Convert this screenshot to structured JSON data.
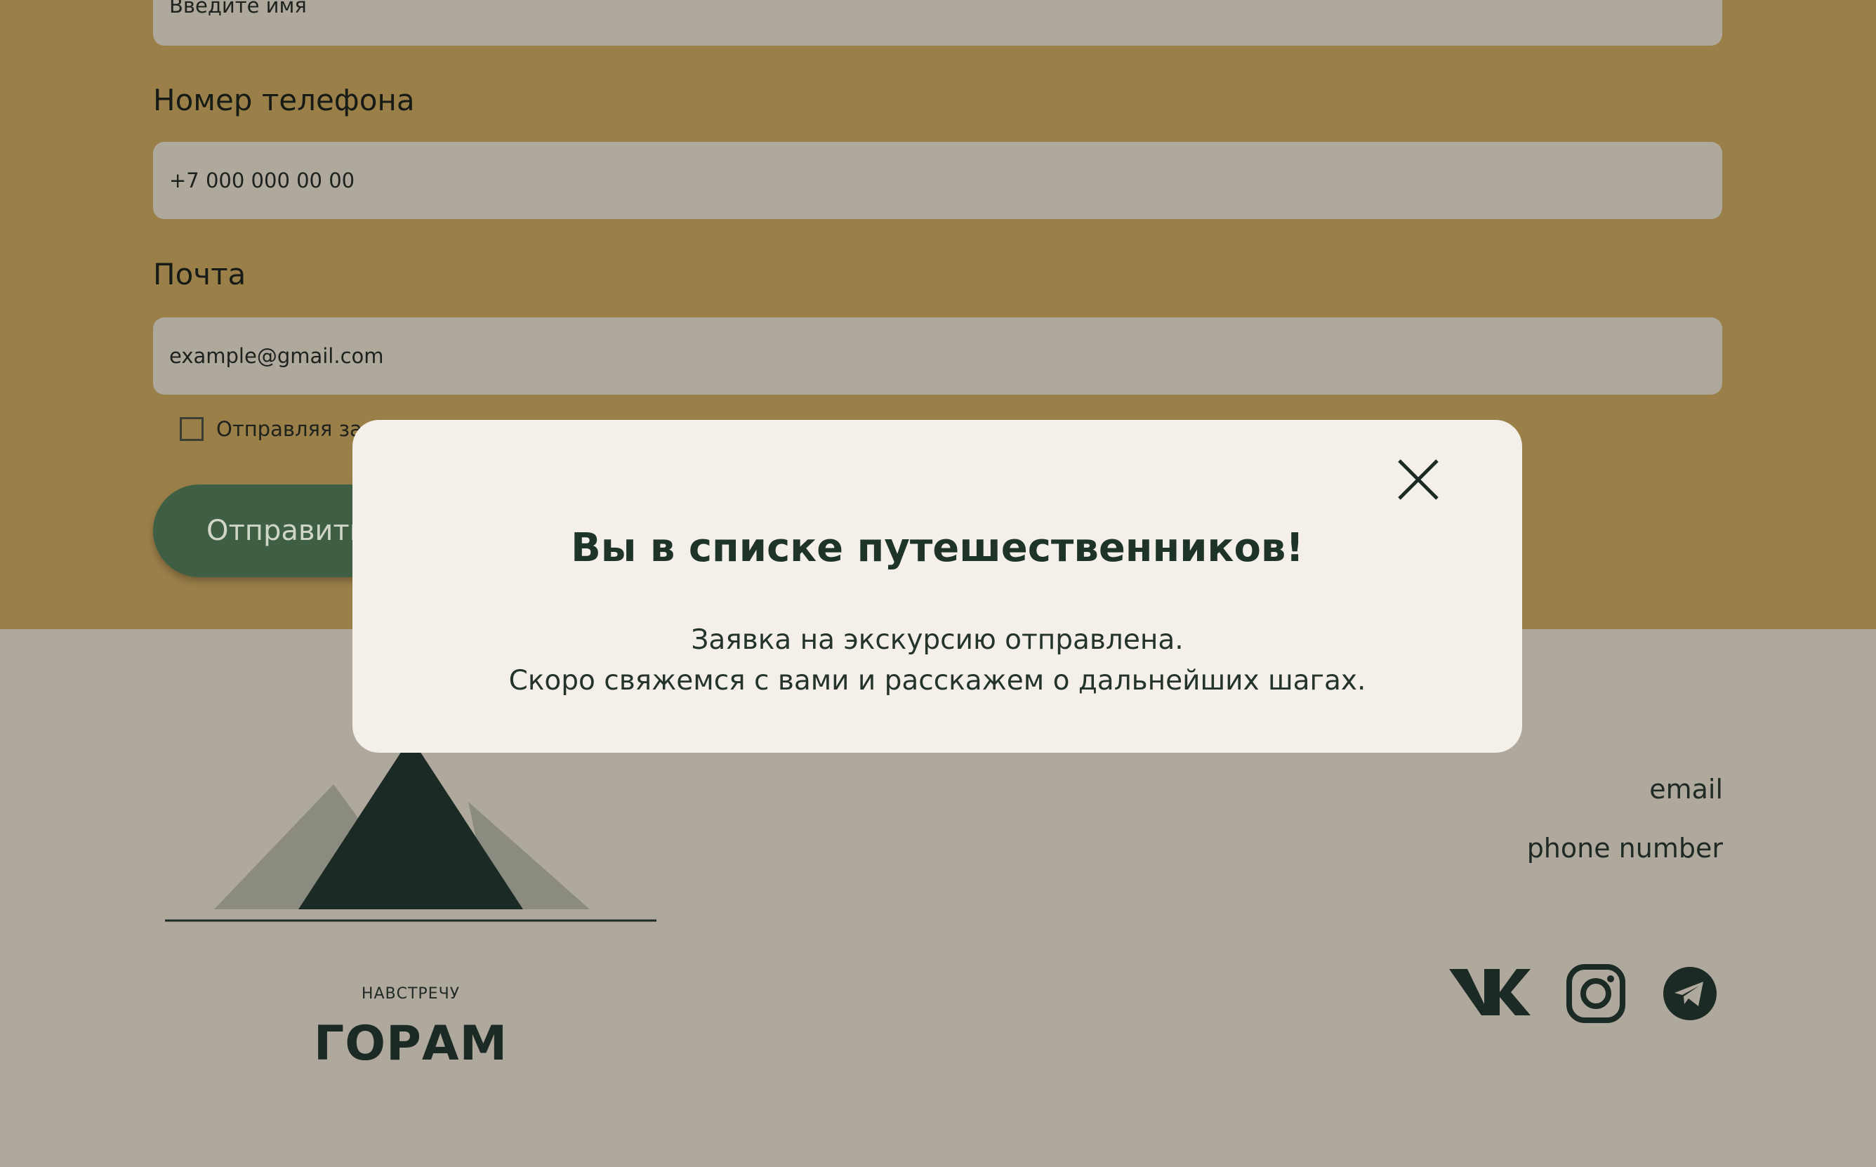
{
  "form": {
    "name_placeholder": "Введите имя",
    "phone_label": "Номер телефона",
    "phone_placeholder": "+7 000 000 00 00",
    "email_label": "Почта",
    "email_placeholder": "example@gmail.com",
    "consent_text": "Отправляя заявку",
    "submit_label": "Отправить"
  },
  "modal": {
    "title": "Вы в списке путешественников!",
    "line1": "Заявка на экскурсию отправлена.",
    "line2": "Скоро свяжемся с вами и расскажем о дальнейших шагах."
  },
  "footer": {
    "brand_top": "НАВСТРЕЧУ",
    "brand_main": "ГОРАМ",
    "email": "email",
    "phone": "phone number",
    "social_icons": [
      "vk-icon",
      "instagram-icon",
      "telegram-icon"
    ]
  },
  "colors": {
    "form_bg": "#9b7f49",
    "footer_bg": "#afa89c",
    "accent_green": "#3f5f45",
    "dark": "#1b2a24"
  }
}
